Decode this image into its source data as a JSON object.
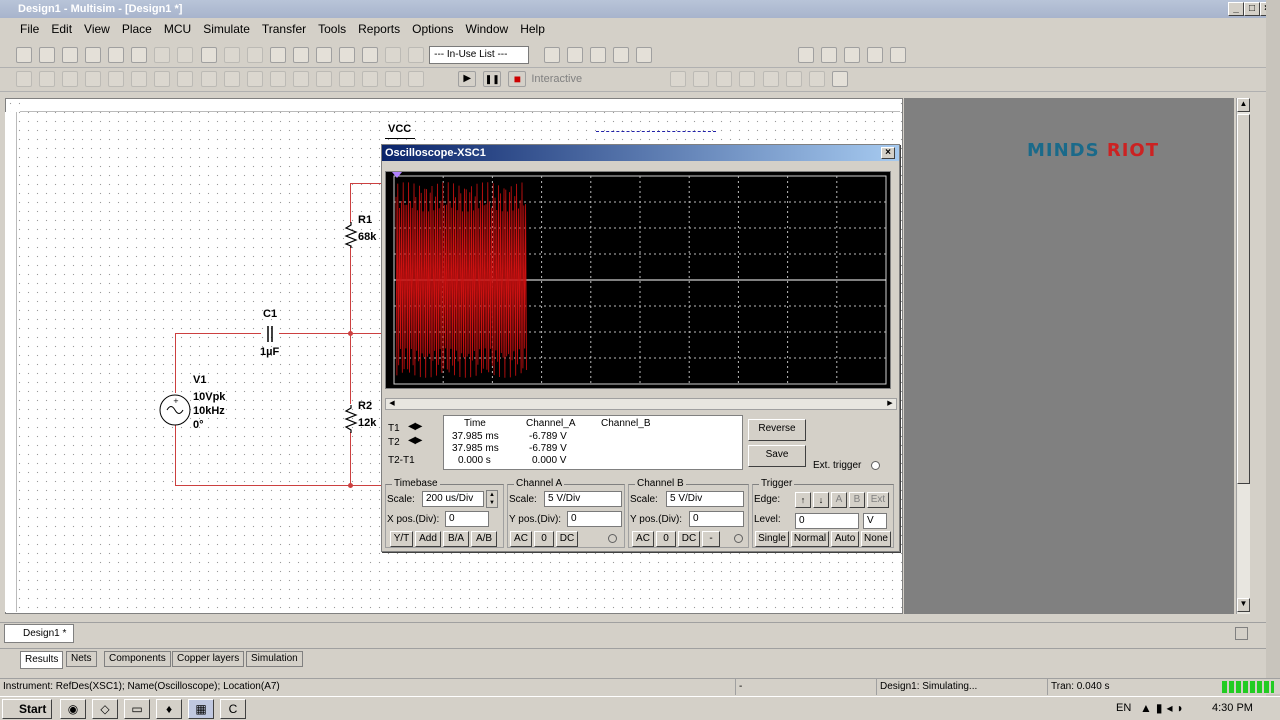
{
  "window": {
    "title": "Design1 - Multisim - [Design1 *]"
  },
  "menu": [
    "File",
    "Edit",
    "View",
    "Place",
    "MCU",
    "Simulate",
    "Transfer",
    "Tools",
    "Reports",
    "Options",
    "Window",
    "Help"
  ],
  "toolbar": {
    "in_use_list": "--- In-Use List ---",
    "interactive_label": "Interactive"
  },
  "logo": {
    "part1": "MINDS",
    "part2": "RIOT",
    "color1": "#1a6a8a",
    "color2": "#cc2222"
  },
  "schematic": {
    "vcc": "VCC",
    "r1_name": "R1",
    "r1_value": "68k",
    "c1_name": "C1",
    "c1_value": "1µF",
    "v1_name": "V1",
    "v1_amp": "10Vpk",
    "v1_freq": "10kHz",
    "v1_phase": "0°",
    "r2_name": "R2",
    "r2_value": "12k"
  },
  "oscilloscope": {
    "title": "Oscilloscope-XSC1",
    "trace_color": "#cc1111",
    "readout": {
      "headers": [
        "Time",
        "Channel_A",
        "Channel_B"
      ],
      "rows": [
        {
          "label": "T1",
          "time": "37.985 ms",
          "a": "-6.789 V",
          "b": ""
        },
        {
          "label": "T2",
          "time": "37.985 ms",
          "a": "-6.789 V",
          "b": ""
        },
        {
          "label": "T2-T1",
          "time": "0.000 s",
          "a": "0.000 V",
          "b": ""
        }
      ]
    },
    "reverse": "Reverse",
    "save": "Save",
    "ext_trigger": "Ext. trigger",
    "timebase": {
      "title": "Timebase",
      "scale_label": "Scale:",
      "scale": "200 us/Div",
      "xpos_label": "X pos.(Div):",
      "xpos": "0",
      "buttons": [
        "Y/T",
        "Add",
        "B/A",
        "A/B"
      ]
    },
    "channel_a": {
      "title": "Channel A",
      "scale_label": "Scale:",
      "scale": "5  V/Div",
      "ypos_label": "Y pos.(Div):",
      "ypos": "0",
      "buttons": [
        "AC",
        "0",
        "DC"
      ]
    },
    "channel_b": {
      "title": "Channel B",
      "scale_label": "Scale:",
      "scale": "5  V/Div",
      "ypos_label": "Y pos.(Div):",
      "ypos": "0",
      "buttons": [
        "AC",
        "0",
        "DC",
        "-"
      ]
    },
    "trigger": {
      "title": "Trigger",
      "edge_label": "Edge:",
      "level_label": "Level:",
      "level": "0",
      "level_unit": "V",
      "edge_buttons": [
        "A",
        "B",
        "Ext"
      ],
      "mode_buttons": [
        "Single",
        "Normal",
        "Auto",
        "None"
      ]
    }
  },
  "tabs": {
    "design": "Design1 *"
  },
  "results_tabs": [
    "Results",
    "Nets",
    "Components",
    "Copper layers",
    "Simulation"
  ],
  "status": {
    "instrument": "Instrument: RefDes(XSC1); Name(Oscilloscope); Location(A7)",
    "dash": "-",
    "sim": "Design1: Simulating...",
    "tran": "Tran: 0.040 s"
  },
  "taskbar": {
    "start": "Start",
    "lang": "EN",
    "time": "4:30 PM"
  }
}
